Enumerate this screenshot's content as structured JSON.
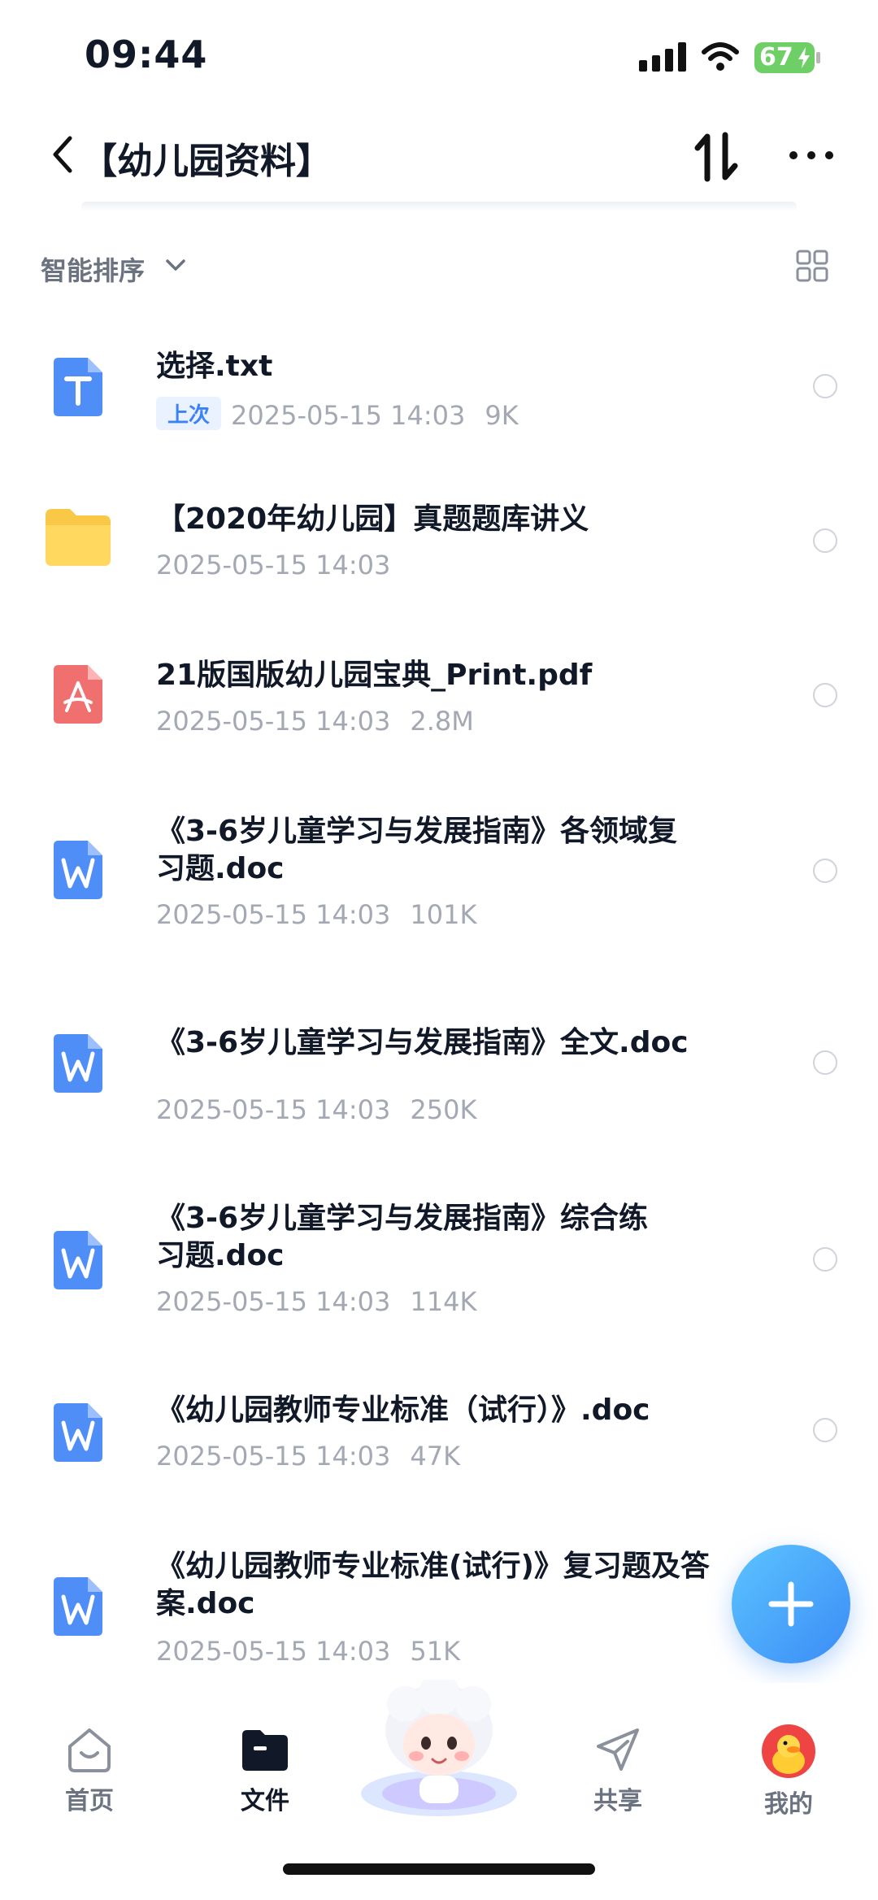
{
  "status_bar": {
    "time": "09:44",
    "battery": "67"
  },
  "header": {
    "title": "【幼儿园资料】"
  },
  "sort": {
    "label": "智能排序"
  },
  "files": [
    {
      "name": "选择.txt",
      "badge": "上次",
      "date": "2025-05-15 14:03",
      "size": "9K",
      "type": "txt"
    },
    {
      "name": "【2020年幼儿园】真题题库讲义",
      "date": "2025-05-15 14:03",
      "size": "",
      "type": "folder"
    },
    {
      "name": "21版国版幼儿园宝典_Print.pdf",
      "date": "2025-05-15 14:03",
      "size": "2.8M",
      "type": "pdf"
    },
    {
      "name": "《3-6岁儿童学习与发展指南》各领域复习题.doc",
      "date": "2025-05-15 14:03",
      "size": "101K",
      "type": "doc"
    },
    {
      "name": "《3-6岁儿童学习与发展指南》全文.doc",
      "date": "2025-05-15 14:03",
      "size": "250K",
      "type": "doc"
    },
    {
      "name": "《3-6岁儿童学习与发展指南》综合练习题.doc",
      "date": "2025-05-15 14:03",
      "size": "114K",
      "type": "doc"
    },
    {
      "name": "《幼儿园教师专业标准（试行）》.doc",
      "date": "2025-05-15 14:03",
      "size": "47K",
      "type": "doc"
    },
    {
      "name": "《幼儿园教师专业标准(试行)》复习题及答案.doc",
      "date": "2025-05-15 14:03",
      "size": "51K",
      "type": "doc"
    }
  ],
  "nav": [
    {
      "label": "首页",
      "icon": "home-icon"
    },
    {
      "label": "文件",
      "icon": "folder-icon"
    },
    {
      "label": "共享",
      "icon": "share-icon"
    },
    {
      "label": "我的",
      "icon": "avatar"
    }
  ],
  "colors": {
    "accent": "#3b82f6",
    "doc": "#4f8ef7",
    "pdf": "#f07070",
    "folder": "#ffd35c"
  }
}
